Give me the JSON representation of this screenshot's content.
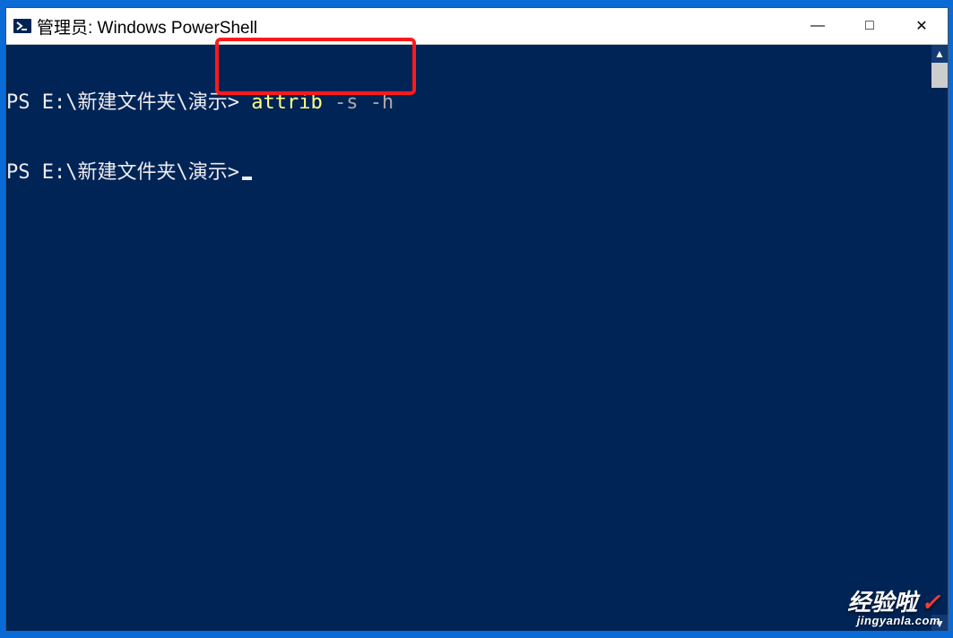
{
  "window": {
    "title": "管理员: Windows PowerShell"
  },
  "terminal": {
    "lines": [
      {
        "prompt": "PS E:\\新建文件夹\\演示>",
        "command": "attrib",
        "args": "-s -h"
      },
      {
        "prompt": "PS E:\\新建文件夹\\演示>",
        "command": "",
        "args": ""
      }
    ]
  },
  "watermark": {
    "line1": "经验啦",
    "check": "✓",
    "line2": "jingyanla.com"
  },
  "titlebar_buttons": {
    "minimize": "—",
    "maximize": "□",
    "close": "✕"
  },
  "scrollbar": {
    "up": "▲",
    "down": "▼"
  }
}
